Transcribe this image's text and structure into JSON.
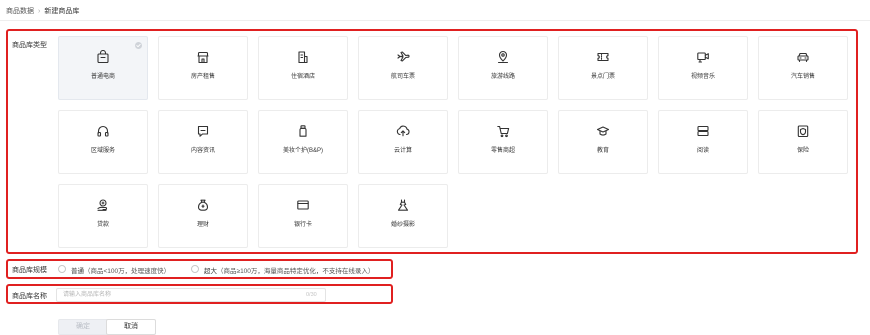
{
  "breadcrumb": {
    "parent": "商品数据",
    "separator": "›",
    "current": "新建商品库"
  },
  "type_section": {
    "label": "商品库类型",
    "cards": [
      {
        "label": "普通电商",
        "icon": "shopping-bag-icon",
        "selected": true
      },
      {
        "label": "房产租售",
        "icon": "house-icon"
      },
      {
        "label": "住宿酒店",
        "icon": "hotel-icon"
      },
      {
        "label": "航司车票",
        "icon": "plane-icon"
      },
      {
        "label": "旅游线路",
        "icon": "location-pin-icon"
      },
      {
        "label": "景点门票",
        "icon": "ticket-icon"
      },
      {
        "label": "视频音乐",
        "icon": "video-camera-icon"
      },
      {
        "label": "汽车销售",
        "icon": "car-icon"
      },
      {
        "label": "区域服务",
        "icon": "headphones-icon"
      },
      {
        "label": "内容资讯",
        "icon": "message-icon"
      },
      {
        "label": "美妆个护(B&P)",
        "icon": "cosmetics-bottle-icon"
      },
      {
        "label": "云计算",
        "icon": "cloud-upload-icon"
      },
      {
        "label": "零售商超",
        "icon": "shopping-cart-icon"
      },
      {
        "label": "教育",
        "icon": "graduation-cap-icon"
      },
      {
        "label": "阅读",
        "icon": "book-stack-icon"
      },
      {
        "label": "保险",
        "icon": "shield-icon"
      },
      {
        "label": "贷款",
        "icon": "coin-hand-icon"
      },
      {
        "label": "理财",
        "icon": "money-bag-icon"
      },
      {
        "label": "银行卡",
        "icon": "bank-card-icon"
      },
      {
        "label": "婚纱摄影",
        "icon": "wedding-dress-icon"
      }
    ]
  },
  "scale": {
    "label": "商品库规模",
    "options": [
      {
        "title": "普通",
        "desc": "（商品<100万，处理速度快）"
      },
      {
        "title": "超大",
        "desc": "（商品≥100万，海量商品特定优化，不支持在线录入）"
      }
    ]
  },
  "name": {
    "label": "商品库名称",
    "placeholder": "请输入商品库名称",
    "value": "",
    "counter": "0/30"
  },
  "actions": {
    "ok_label": "确定",
    "cancel_label": "取消"
  },
  "colors": {
    "highlight_border": "#e02020",
    "card_border": "#ececec",
    "selected_card_bg": "#f3f5f8"
  }
}
